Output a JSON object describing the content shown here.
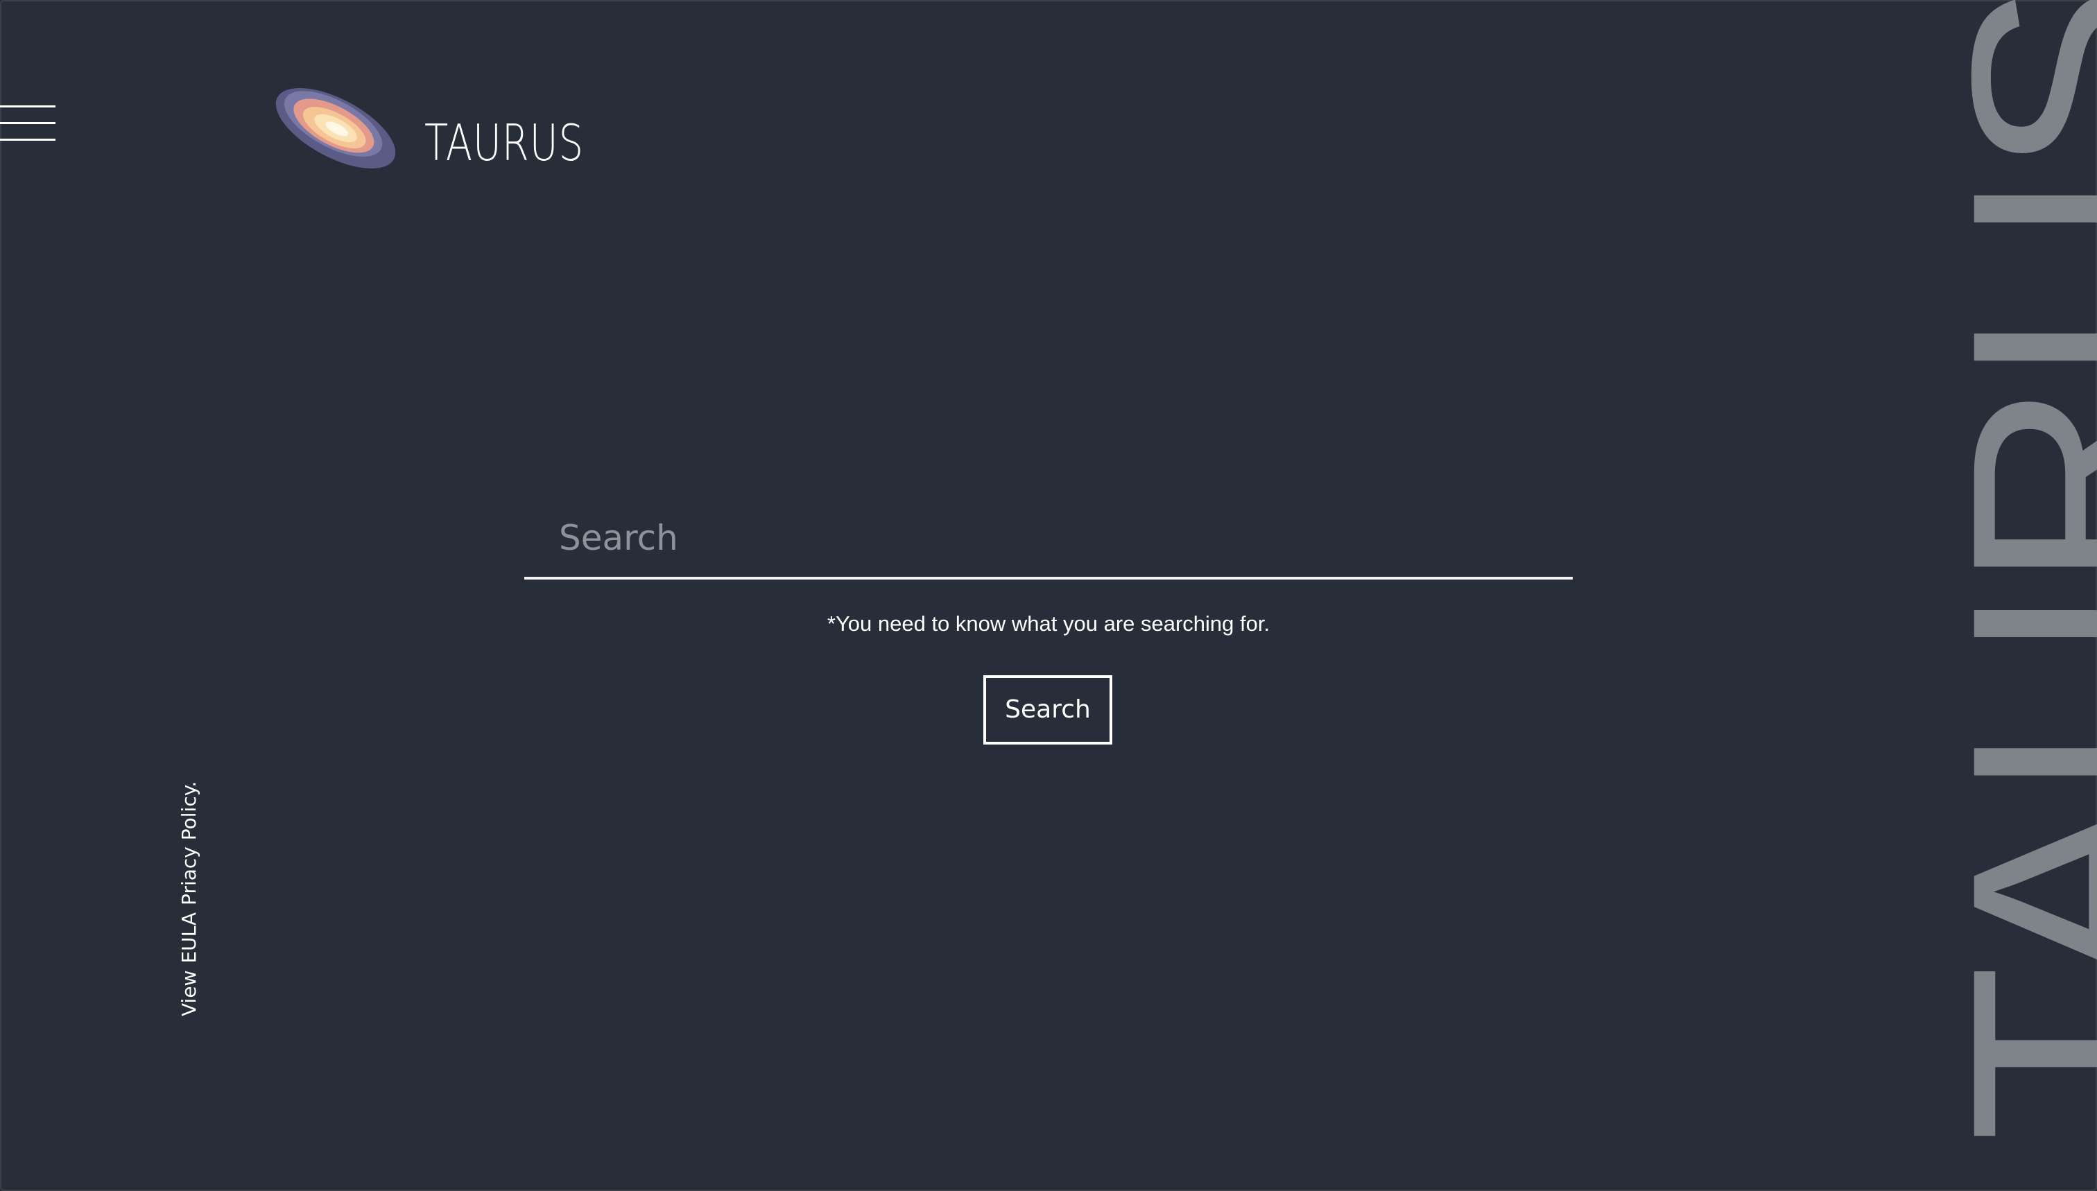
{
  "brand": {
    "name": "TAURUS",
    "watermark": "TAURUS"
  },
  "icons": {
    "menu": "hamburger-menu-icon",
    "logo": "galaxy-logo-icon"
  },
  "search": {
    "placeholder": "Search",
    "value": "",
    "hint": "*You need to know what you are searching for.",
    "button_label": "Search"
  },
  "legal": {
    "prefix": "View",
    "eula": "EULA",
    "privacy": "Priacy Policy."
  },
  "colors": {
    "background": "#282e39",
    "text": "#ffffff",
    "watermark": "#7f838a",
    "placeholder": "#8e929a"
  }
}
